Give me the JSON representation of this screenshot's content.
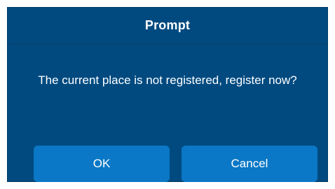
{
  "dialog": {
    "title": "Prompt",
    "message": "The current place is not registered, register now?",
    "ok_label": "OK",
    "cancel_label": "Cancel"
  },
  "colors": {
    "dialog_background": "#004a80",
    "button_background": "#0a78c6",
    "text": "#ffffff",
    "page_background": "#ffffff"
  }
}
